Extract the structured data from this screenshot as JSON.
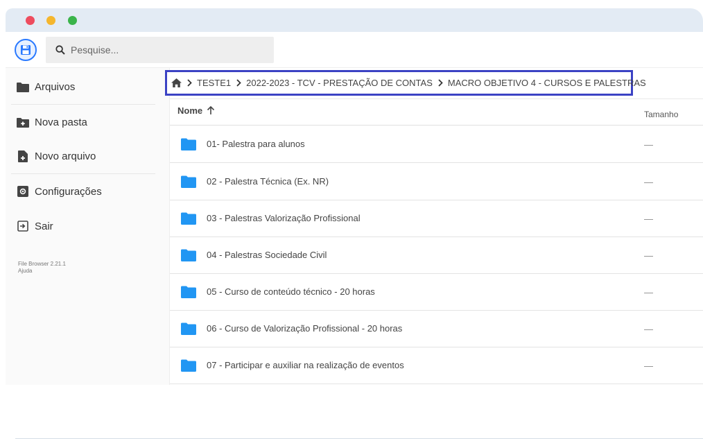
{
  "window": {
    "traffic_lights": [
      {
        "name": "close",
        "color": "#ee4c5e"
      },
      {
        "name": "minimize",
        "color": "#f5b62d"
      },
      {
        "name": "maximize",
        "color": "#3ab44a"
      }
    ]
  },
  "colors": {
    "accent": "#2979ff",
    "folder": "#2196f3",
    "breadcrumb_highlight": "#3b42c4"
  },
  "header": {
    "logo_icon": "floppy-disk-icon",
    "search": {
      "placeholder": "Pesquise...",
      "icon": "search-icon"
    }
  },
  "sidebar": {
    "items": [
      {
        "label": "Arquivos",
        "icon": "folder-icon"
      },
      {
        "label": "Nova pasta",
        "icon": "new-folder-icon"
      },
      {
        "label": "Novo arquivo",
        "icon": "new-file-icon"
      },
      {
        "label": "Configurações",
        "icon": "settings-icon"
      },
      {
        "label": "Sair",
        "icon": "logout-icon"
      }
    ],
    "credits": {
      "version": "File Browser 2.21.1",
      "help": "Ajuda"
    }
  },
  "breadcrumb": {
    "home_icon": "home-icon",
    "items": [
      "TESTE1",
      "2022-2023 - TCV - PRESTAÇÃO DE CONTAS",
      "MACRO OBJETIVO 4 - CURSOS E PALESTRAS"
    ]
  },
  "table": {
    "columns": {
      "name": "Nome",
      "size": "Tamanho"
    },
    "sort": {
      "column": "name",
      "direction": "ascending",
      "icon": "arrow-up-icon"
    },
    "rows": [
      {
        "name": "01- Palestra para alunos",
        "size": "—"
      },
      {
        "name": "02 - Palestra Técnica (Ex. NR)",
        "size": "—"
      },
      {
        "name": "03 - Palestras Valorização Profissional",
        "size": "—"
      },
      {
        "name": "04 - Palestras Sociedade Civil",
        "size": "—"
      },
      {
        "name": "05 - Curso de conteúdo técnico - 20 horas",
        "size": "—"
      },
      {
        "name": "06 - Curso de Valorização Profissional - 20 horas",
        "size": "—"
      },
      {
        "name": "07 - Participar e auxiliar na realização de eventos",
        "size": "—"
      }
    ]
  }
}
